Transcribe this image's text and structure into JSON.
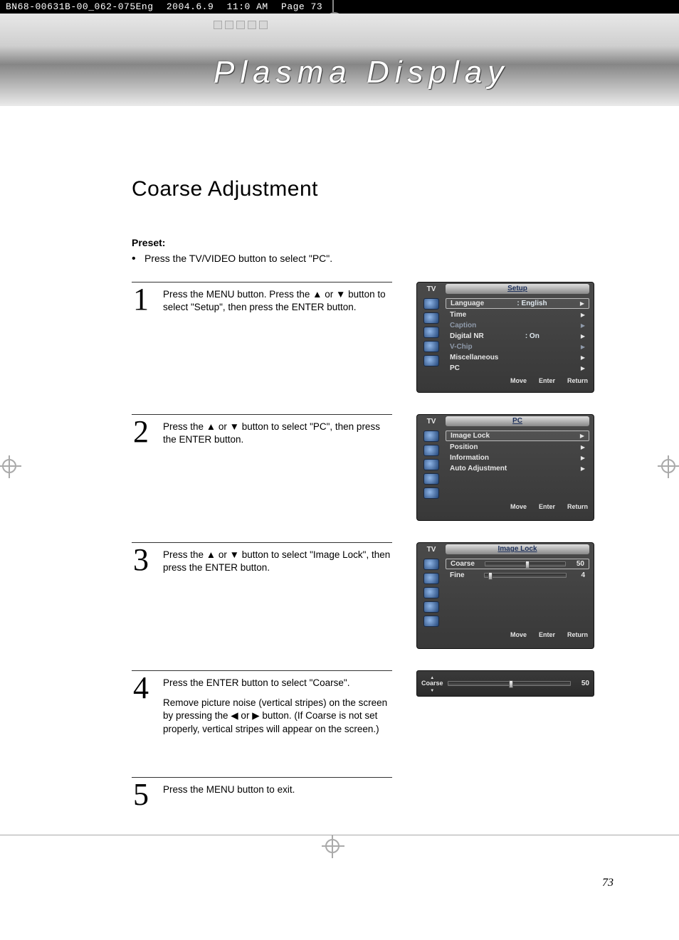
{
  "preprint": {
    "doc_id": "BN68-00631B-00_062-075Eng",
    "date": "2004.6.9",
    "time": "11:0 AM",
    "page_ref": "Page 73"
  },
  "banner_title": "Plasma Display",
  "page_title": "Coarse Adjustment",
  "preset": {
    "label": "Preset:",
    "bullet1": "Press the TV/VIDEO button to select \"PC\"."
  },
  "steps": {
    "s1": {
      "num": "1",
      "text": "Press the MENU button. Press the ▲ or ▼ button to select \"Setup\", then press the ENTER button."
    },
    "s2": {
      "num": "2",
      "text": "Press the ▲ or ▼ button to select \"PC\", then press the ENTER button."
    },
    "s3": {
      "num": "3",
      "text": "Press the ▲ or ▼ button to select \"Image Lock\", then press the ENTER button."
    },
    "s4": {
      "num": "4",
      "p1": "Press the ENTER button to select \"Coarse\".",
      "p2": "Remove picture noise (vertical stripes) on the screen by pressing the ◀ or ▶ button. (If Coarse is not set properly, vertical stripes will appear on the screen.)"
    },
    "s5": {
      "num": "5",
      "text": "Press the MENU button to exit."
    }
  },
  "osd_common": {
    "tv": "TV",
    "move": "Move",
    "enter": "Enter",
    "return": "Return",
    "arrow": "▶"
  },
  "osd1": {
    "title": "Setup",
    "rows": {
      "language": {
        "label": "Language",
        "val": ":  English"
      },
      "time": {
        "label": "Time"
      },
      "caption": {
        "label": "Caption"
      },
      "digitalnr": {
        "label": "Digital NR",
        "val": ":  On"
      },
      "vchip": {
        "label": "V-Chip"
      },
      "misc": {
        "label": "Miscellaneous"
      },
      "pc": {
        "label": "PC"
      }
    }
  },
  "osd2": {
    "title": "PC",
    "rows": {
      "imagelock": {
        "label": "Image Lock"
      },
      "position": {
        "label": "Position"
      },
      "information": {
        "label": "Information"
      },
      "autoadj": {
        "label": "Auto Adjustment"
      }
    }
  },
  "osd3": {
    "title": "Image Lock",
    "coarse": {
      "label": "Coarse",
      "value": "50",
      "thumb_percent": 50
    },
    "fine": {
      "label": "Fine",
      "value": "4",
      "thumb_percent": 4
    }
  },
  "osd4": {
    "label": "Coarse",
    "value": "50",
    "thumb_percent": 50
  },
  "page_number": "73"
}
